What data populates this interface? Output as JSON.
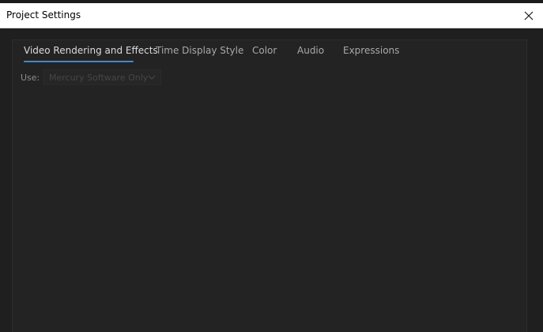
{
  "window": {
    "title": "Project Settings"
  },
  "tabs": [
    {
      "label": "Video Rendering and Effects",
      "active": true
    },
    {
      "label": "Time Display Style",
      "active": false
    },
    {
      "label": "Color",
      "active": false
    },
    {
      "label": "Audio",
      "active": false
    },
    {
      "label": "Expressions",
      "active": false
    }
  ],
  "video_rendering": {
    "use_label": "Use:",
    "renderer_select": {
      "value": "Mercury Software Only",
      "enabled": false
    }
  },
  "colors": {
    "accent": "#2d8ceb",
    "titlebar_bg": "#ffffff",
    "panel_bg": "#232323"
  },
  "icons": {
    "close": "close-icon",
    "dropdown": "chevron-down-icon"
  }
}
